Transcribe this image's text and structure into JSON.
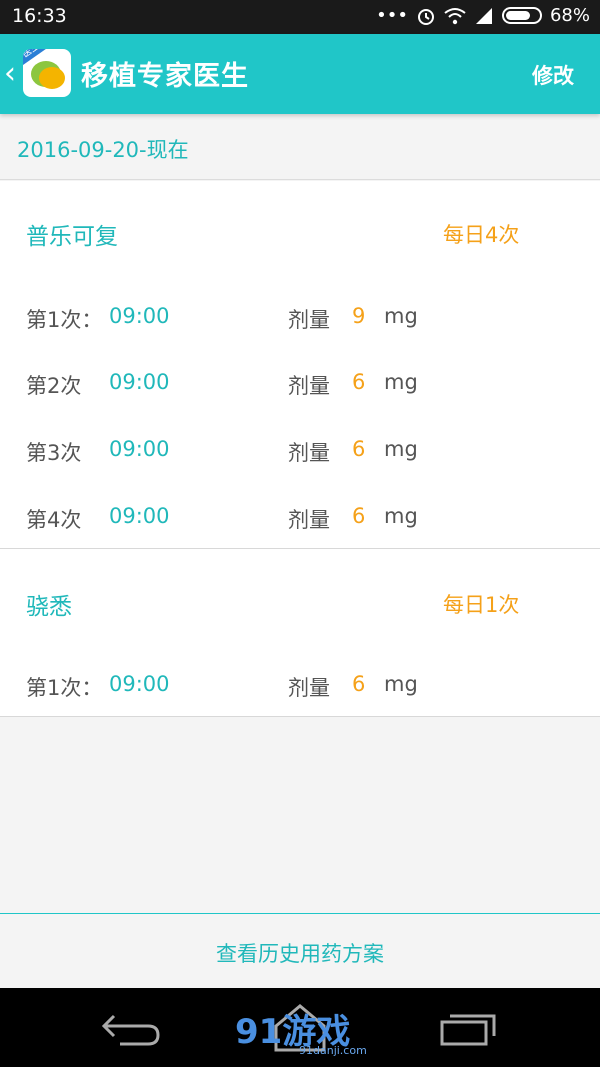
{
  "status_bar": {
    "time": "16:33",
    "dots": "•••",
    "battery": "68%"
  },
  "app_bar": {
    "back_glyph": "‹",
    "logo_tag": "医生",
    "title": "移植专家医生",
    "edit_label": "修改"
  },
  "date_range": "2016-09-20-现在",
  "drugs": [
    {
      "name": "普乐可复",
      "frequency": "每日4次",
      "doses": [
        {
          "label": "第1次：",
          "time": "09:00",
          "dose_label": "剂量",
          "amount": "9",
          "unit": "mg"
        },
        {
          "label": "第2次",
          "time": "09:00",
          "dose_label": "剂量",
          "amount": "6",
          "unit": "mg"
        },
        {
          "label": "第3次",
          "time": "09:00",
          "dose_label": "剂量",
          "amount": "6",
          "unit": "mg"
        },
        {
          "label": "第4次",
          "time": "09:00",
          "dose_label": "剂量",
          "amount": "6",
          "unit": "mg"
        }
      ]
    },
    {
      "name": "骁悉",
      "frequency": "每日1次",
      "doses": [
        {
          "label": "第1次：",
          "time": "09:00",
          "dose_label": "剂量",
          "amount": "6",
          "unit": "mg"
        }
      ]
    }
  ],
  "history_link": "查看历史用药方案",
  "watermark": {
    "text": "91游戏",
    "sub": "91danji.com"
  },
  "colors": {
    "accent": "#20c6c8",
    "orange": "#f5a119",
    "text_gray": "#555555"
  },
  "icons": [
    "wifi-icon",
    "signal-icon",
    "alarm-icon",
    "battery-icon",
    "back-nav-icon",
    "home-nav-icon",
    "recent-apps-icon"
  ]
}
